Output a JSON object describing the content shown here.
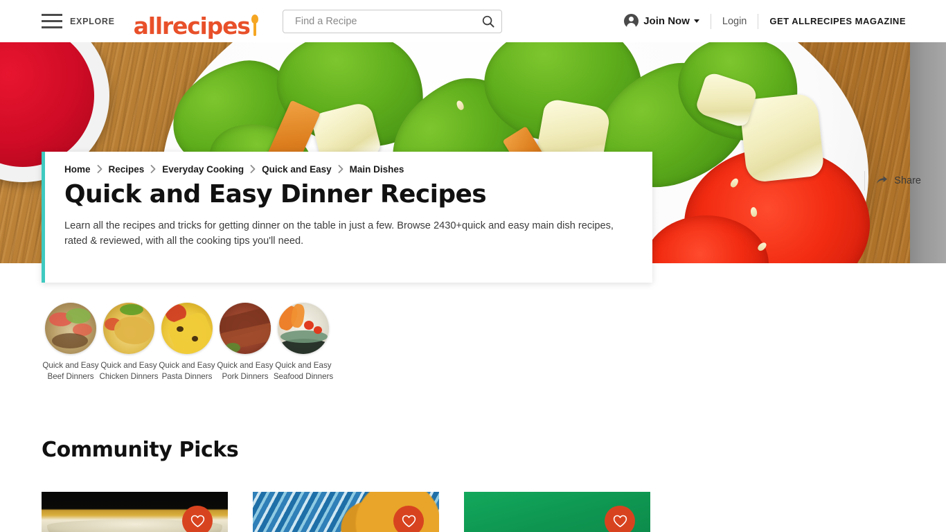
{
  "header": {
    "explore_label": "EXPLORE",
    "logo_text": "allrecipes",
    "logo_color": "#e8502a",
    "search": {
      "placeholder": "Find a Recipe",
      "value": ""
    },
    "join_now_label": "Join Now",
    "login_label": "Login",
    "magazine_label": "GET ALLRECIPES MAGAZINE"
  },
  "breadcrumb": {
    "items": [
      {
        "label": "Home"
      },
      {
        "label": "Recipes"
      },
      {
        "label": "Everyday Cooking"
      },
      {
        "label": "Quick and Easy"
      },
      {
        "label": "Main Dishes"
      }
    ],
    "separator": "›"
  },
  "share": {
    "label": "Share"
  },
  "main": {
    "title": "Quick and Easy Dinner Recipes",
    "description": "Learn all the recipes and tricks for getting dinner on the table in just a few. Browse 2430+quick and easy main dish recipes, rated & reviewed, with all the cooking tips you'll need.",
    "recipe_count": "2430+",
    "accent_color": "#3fc9c0"
  },
  "categories": [
    {
      "label": "Quick and Easy Beef Dinners",
      "art": "c-beef"
    },
    {
      "label": "Quick and Easy Chicken Dinners",
      "art": "c-chicken"
    },
    {
      "label": "Quick and Easy Pasta Dinners",
      "art": "c-pasta"
    },
    {
      "label": "Quick and Easy Pork Dinners",
      "art": "c-pork"
    },
    {
      "label": "Quick and Easy Seafood Dinners",
      "art": "c-seafood"
    }
  ],
  "community_picks": {
    "title": "Community Picks",
    "favorite_button_color": "#d8431f",
    "cards": [
      {
        "photo": "photo-1",
        "fav_icon": "heart-icon"
      },
      {
        "photo": "photo-2",
        "fav_icon": "heart-icon"
      },
      {
        "photo": "photo-3",
        "fav_icon": "heart-icon"
      }
    ]
  }
}
